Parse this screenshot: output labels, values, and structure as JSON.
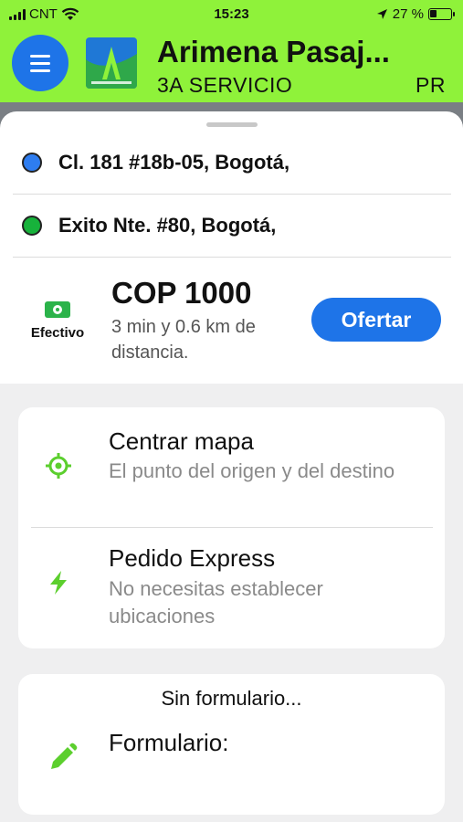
{
  "status_bar": {
    "carrier": "CNT",
    "time": "15:23",
    "battery": "27 %"
  },
  "header": {
    "title": "Arimena Pasaj...",
    "marquee_left": "3A SERVICIO",
    "marquee_right": "PR"
  },
  "route": {
    "origin": "Cl. 181 #18b-05, Bogotá,",
    "destination": "Exito Nte. #80, Bogotá,",
    "colors": {
      "origin": "#2e7df0",
      "destination": "#17b23b"
    }
  },
  "trip": {
    "payment_label": "Efectivo",
    "price": "COP 1000",
    "eta": "3 min y 0.6 km de distancia.",
    "offer_button": "Ofertar"
  },
  "options": [
    {
      "title": "Centrar mapa",
      "subtitle": "El punto del origen y del destino",
      "icon": "crosshair-icon"
    },
    {
      "title": "Pedido Express",
      "subtitle": "No necesitas establecer ubicaciones",
      "icon": "lightning-icon"
    }
  ],
  "form": {
    "heading": "Sin formulario...",
    "label": "Formulario:",
    "icon": "pencil-icon"
  },
  "colors": {
    "brand_green": "#8ff23a",
    "accent_blue": "#1e74e8",
    "icon_green": "#5ccf2e"
  }
}
